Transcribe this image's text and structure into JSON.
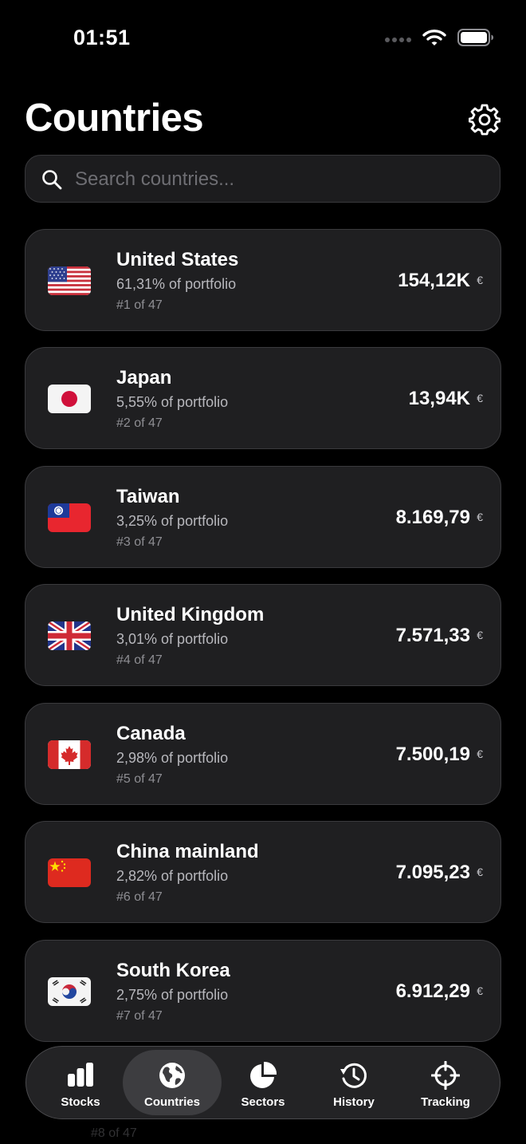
{
  "status_bar": {
    "time": "01:51",
    "icons": [
      "signal-dots-icon",
      "wifi-icon",
      "battery-icon"
    ]
  },
  "header": {
    "title": "Countries",
    "settings_icon": "gear-icon"
  },
  "search": {
    "placeholder": "Search countries..."
  },
  "countries": [
    {
      "name": "United States",
      "pct": "61,31% of portfolio",
      "rank": "#1 of 47",
      "value": "154,12K",
      "currency": "€",
      "flag": "us"
    },
    {
      "name": "Japan",
      "pct": "5,55% of portfolio",
      "rank": "#2 of 47",
      "value": "13,94K",
      "currency": "€",
      "flag": "jp"
    },
    {
      "name": "Taiwan",
      "pct": "3,25% of portfolio",
      "rank": "#3 of 47",
      "value": "8.169,79",
      "currency": "€",
      "flag": "tw"
    },
    {
      "name": "United Kingdom",
      "pct": "3,01% of portfolio",
      "rank": "#4 of 47",
      "value": "7.571,33",
      "currency": "€",
      "flag": "gb"
    },
    {
      "name": "Canada",
      "pct": "2,98% of portfolio",
      "rank": "#5 of 47",
      "value": "7.500,19",
      "currency": "€",
      "flag": "ca"
    },
    {
      "name": "China mainland",
      "pct": "2,82% of portfolio",
      "rank": "#6 of 47",
      "value": "7.095,23",
      "currency": "€",
      "flag": "cn"
    },
    {
      "name": "South Korea",
      "pct": "2,75% of portfolio",
      "rank": "#7 of 47",
      "value": "6.912,29",
      "currency": "€",
      "flag": "kr"
    }
  ],
  "behind_tabbar": {
    "rank": "#8 of 47"
  },
  "tabs": [
    {
      "label": "Stocks",
      "icon": "bar-chart-icon",
      "active": false
    },
    {
      "label": "Countries",
      "icon": "globe-icon",
      "active": true
    },
    {
      "label": "Sectors",
      "icon": "pie-chart-icon",
      "active": false
    },
    {
      "label": "History",
      "icon": "history-clock-icon",
      "active": false
    },
    {
      "label": "Tracking",
      "icon": "crosshair-icon",
      "active": false
    }
  ]
}
